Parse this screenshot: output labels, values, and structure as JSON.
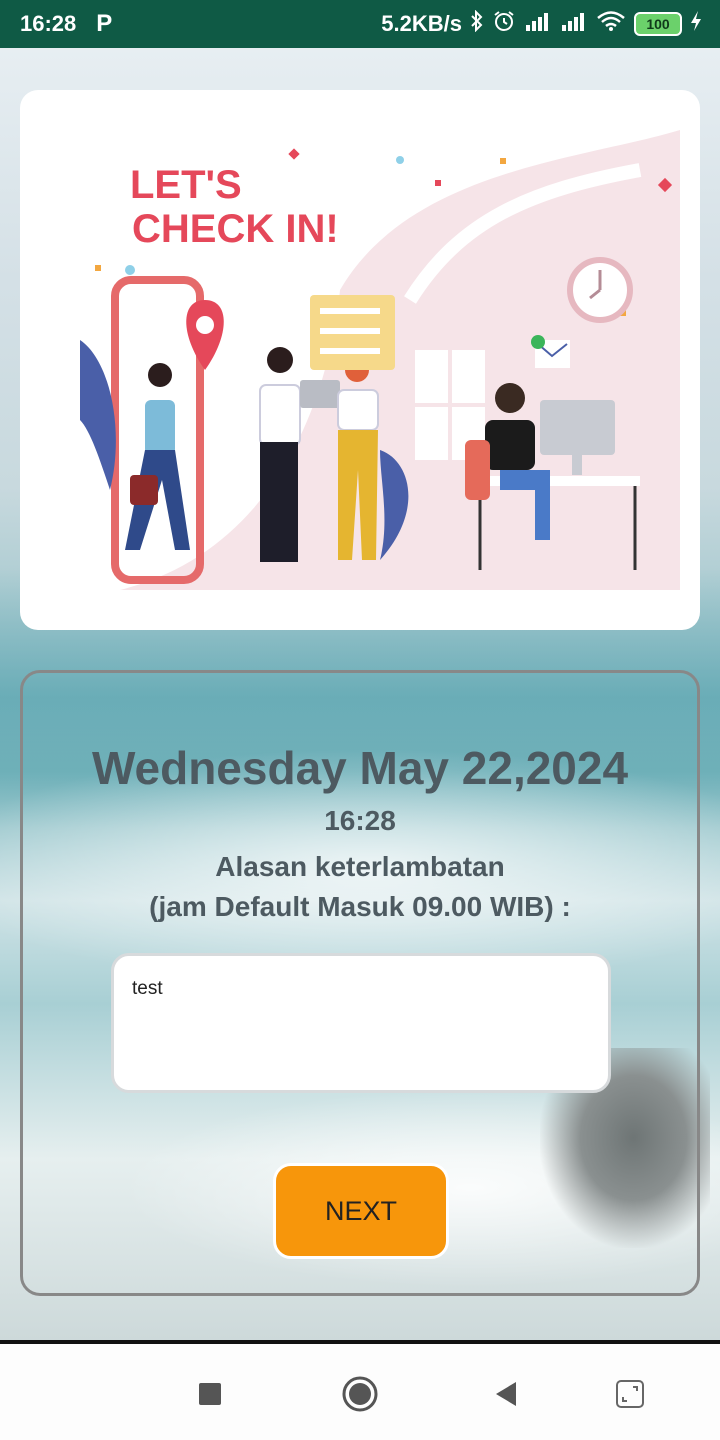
{
  "status_bar": {
    "time": "16:28",
    "carrier_icon": "P",
    "network_speed": "5.2KB/s",
    "battery_level": "100"
  },
  "illustration": {
    "headline_line1": "LET'S",
    "headline_line2": "CHECK IN!"
  },
  "checkin": {
    "date": "Wednesday May 22,2024",
    "time": "16:28",
    "reason_label": "Alasan keterlambatan",
    "reason_hint": "(jam Default Masuk 09.00 WIB)  :",
    "reason_value": "test",
    "next_label": "NEXT"
  },
  "nav_bar": {
    "icons": [
      "square-icon",
      "home-circle-icon",
      "back-triangle-icon",
      "rotate-icon"
    ]
  },
  "colors": {
    "status_bar": "#0f5a45",
    "accent_button": "#f7960b",
    "text": "#4d5a61",
    "battery": "#6bd16b"
  }
}
